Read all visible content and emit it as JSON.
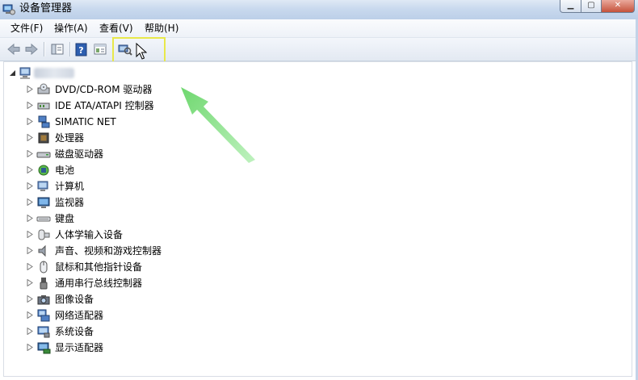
{
  "window": {
    "title": "设备管理器",
    "controls": {
      "minimize": "▁",
      "maximize": "▢",
      "close": "✕"
    }
  },
  "menubar": {
    "items": [
      {
        "label": "文件(F)"
      },
      {
        "label": "操作(A)"
      },
      {
        "label": "查看(V)"
      },
      {
        "label": "帮助(H)"
      }
    ]
  },
  "toolbar": {
    "buttons": [
      "back-arrow-icon",
      "forward-arrow-icon",
      "show-hide-console-tree-icon",
      "help-icon",
      "properties-icon",
      "scan-hardware-changes-icon"
    ],
    "highlight_color": "#e8e84a"
  },
  "tree": {
    "root": {
      "name_redacted": true
    },
    "items": [
      {
        "label": "DVD/CD-ROM 驱动器",
        "icon": "dvd-drive-icon"
      },
      {
        "label": "IDE ATA/ATAPI 控制器",
        "icon": "ide-controller-icon"
      },
      {
        "label": "SIMATIC NET",
        "icon": "network-icon"
      },
      {
        "label": "处理器",
        "icon": "processor-icon"
      },
      {
        "label": "磁盘驱动器",
        "icon": "disk-drive-icon"
      },
      {
        "label": "电池",
        "icon": "battery-icon"
      },
      {
        "label": "计算机",
        "icon": "computer-icon"
      },
      {
        "label": "监视器",
        "icon": "monitor-icon"
      },
      {
        "label": "键盘",
        "icon": "keyboard-icon"
      },
      {
        "label": "人体学输入设备",
        "icon": "hid-icon"
      },
      {
        "label": "声音、视频和游戏控制器",
        "icon": "sound-icon"
      },
      {
        "label": "鼠标和其他指针设备",
        "icon": "mouse-icon"
      },
      {
        "label": "通用串行总线控制器",
        "icon": "usb-icon"
      },
      {
        "label": "图像设备",
        "icon": "camera-icon"
      },
      {
        "label": "网络适配器",
        "icon": "network-adapter-icon"
      },
      {
        "label": "系统设备",
        "icon": "system-device-icon"
      },
      {
        "label": "显示适配器",
        "icon": "display-adapter-icon"
      }
    ]
  },
  "annotation": {
    "arrow_color": "#6fdc6f"
  }
}
